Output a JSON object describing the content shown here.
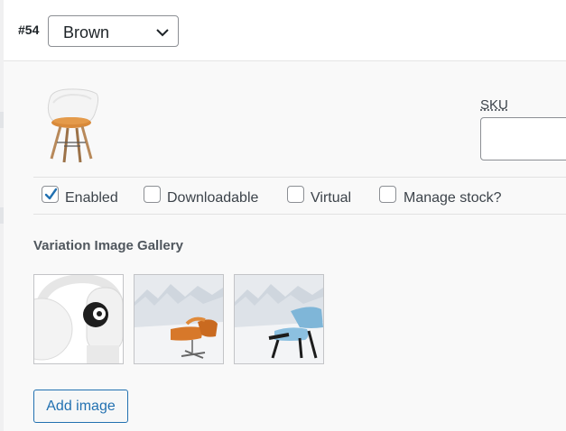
{
  "variation": {
    "number": "#54",
    "attribute_value": "Brown"
  },
  "fields": {
    "sku_label": "SKU",
    "sku_value": ""
  },
  "options": [
    {
      "label": "Enabled",
      "checked": true
    },
    {
      "label": "Downloadable",
      "checked": false
    },
    {
      "label": "Virtual",
      "checked": false
    },
    {
      "label": "Manage stock?",
      "checked": false
    }
  ],
  "gallery": {
    "title": "Variation Image Gallery",
    "images": [
      "white-headphones-image",
      "orange-lounge-chair-image",
      "blue-lounge-chair-image"
    ],
    "add_label": "Add image"
  },
  "colors": {
    "accent": "#2271b1",
    "checkbox_check": "#2271b1",
    "border": "#8c8f94"
  },
  "icons": {
    "select_chevron": "chevron-down-icon",
    "check": "checkmark-icon"
  }
}
